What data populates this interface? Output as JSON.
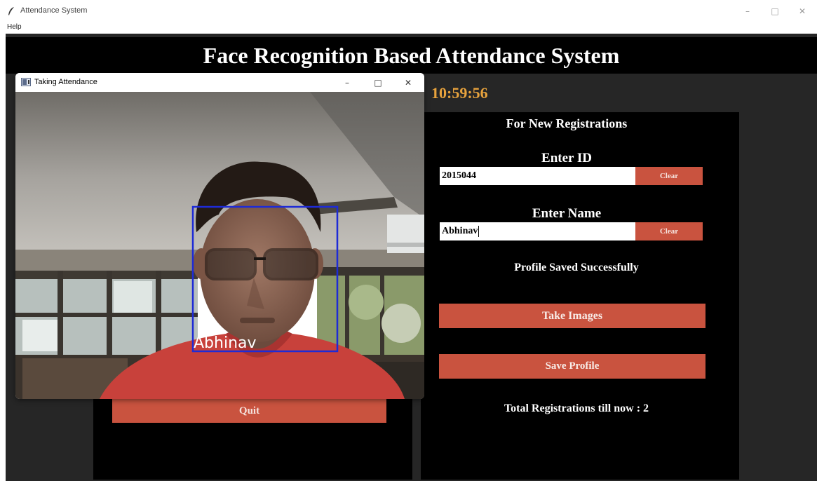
{
  "window": {
    "title": "Attendance System",
    "icon": "feather-icon",
    "controls": [
      "minimize-icon",
      "maximize-icon",
      "close-icon"
    ]
  },
  "menu": {
    "help": "Help"
  },
  "app": {
    "heading": "Face Recognition Based Attendance System",
    "clock": "10:59:56",
    "quit_label": "Quit"
  },
  "registration": {
    "heading": "For New Registrations",
    "id_label": "Enter ID",
    "id_value": "2015044",
    "id_clear": "Clear",
    "name_label": "Enter Name",
    "name_value": "Abhinav",
    "name_clear": "Clear",
    "status": "Profile Saved Successfully",
    "take_images": "Take Images",
    "save_profile": "Save Profile",
    "total": "Total Registrations till now  : 2"
  },
  "camera_window": {
    "title": "Taking Attendance",
    "face_label": "Abhinav"
  },
  "colors": {
    "button": "#c9533f",
    "clock": "#e8a33d",
    "panel": "#000000",
    "background": "#262626",
    "face_box": "#1e2bd6"
  }
}
